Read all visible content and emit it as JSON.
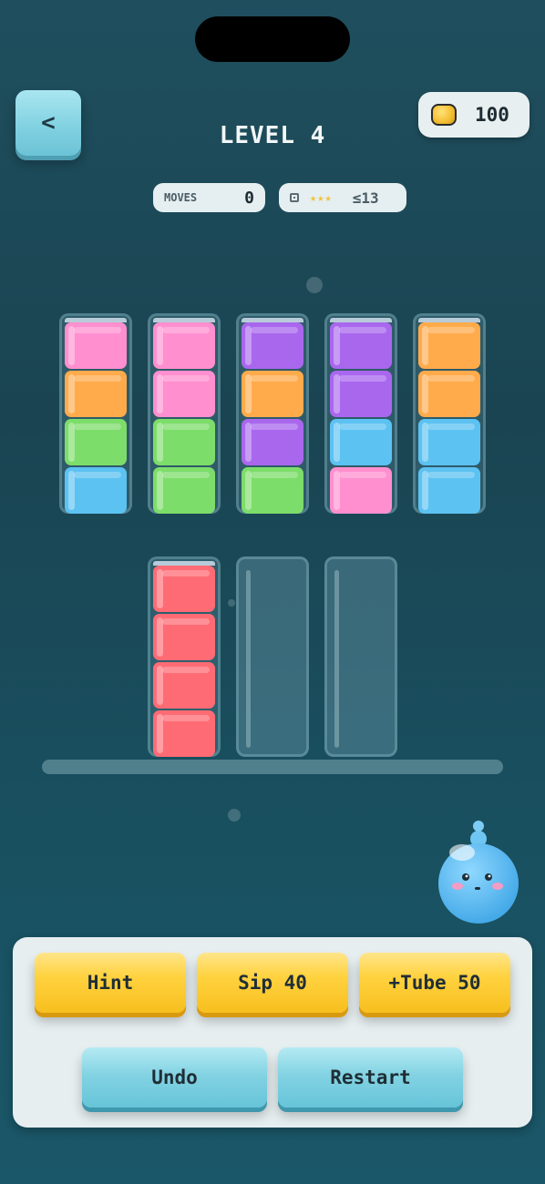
{
  "header": {
    "back_label": "<",
    "level_title": "LEVEL 4",
    "coins": "100"
  },
  "stats": {
    "moves_label": "MOVES",
    "moves_value": "0",
    "stars": "★★★",
    "target": "≤13"
  },
  "colors": {
    "pink": "#ff8fcf",
    "orange": "#ffab4c",
    "green": "#7ddd6a",
    "blue": "#5cc2f2",
    "purple": "#a967ee",
    "red": "#ff6b74"
  },
  "tubes": [
    {
      "row": 1,
      "contents_top_to_bottom": [
        "pink",
        "orange",
        "green",
        "blue"
      ]
    },
    {
      "row": 1,
      "contents_top_to_bottom": [
        "pink",
        "pink",
        "green",
        "green"
      ]
    },
    {
      "row": 1,
      "contents_top_to_bottom": [
        "purple",
        "orange",
        "purple",
        "green"
      ]
    },
    {
      "row": 1,
      "contents_top_to_bottom": [
        "purple",
        "purple",
        "blue",
        "pink"
      ]
    },
    {
      "row": 1,
      "contents_top_to_bottom": [
        "orange",
        "orange",
        "blue",
        "blue"
      ]
    },
    {
      "row": 2,
      "contents_top_to_bottom": [
        "red",
        "red",
        "red",
        "red"
      ]
    },
    {
      "row": 2,
      "contents_top_to_bottom": []
    },
    {
      "row": 2,
      "contents_top_to_bottom": []
    }
  ],
  "actions": {
    "hint": "Hint",
    "sip": "Sip 40",
    "add_tube": "+Tube 50",
    "undo": "Undo",
    "restart": "Restart"
  }
}
